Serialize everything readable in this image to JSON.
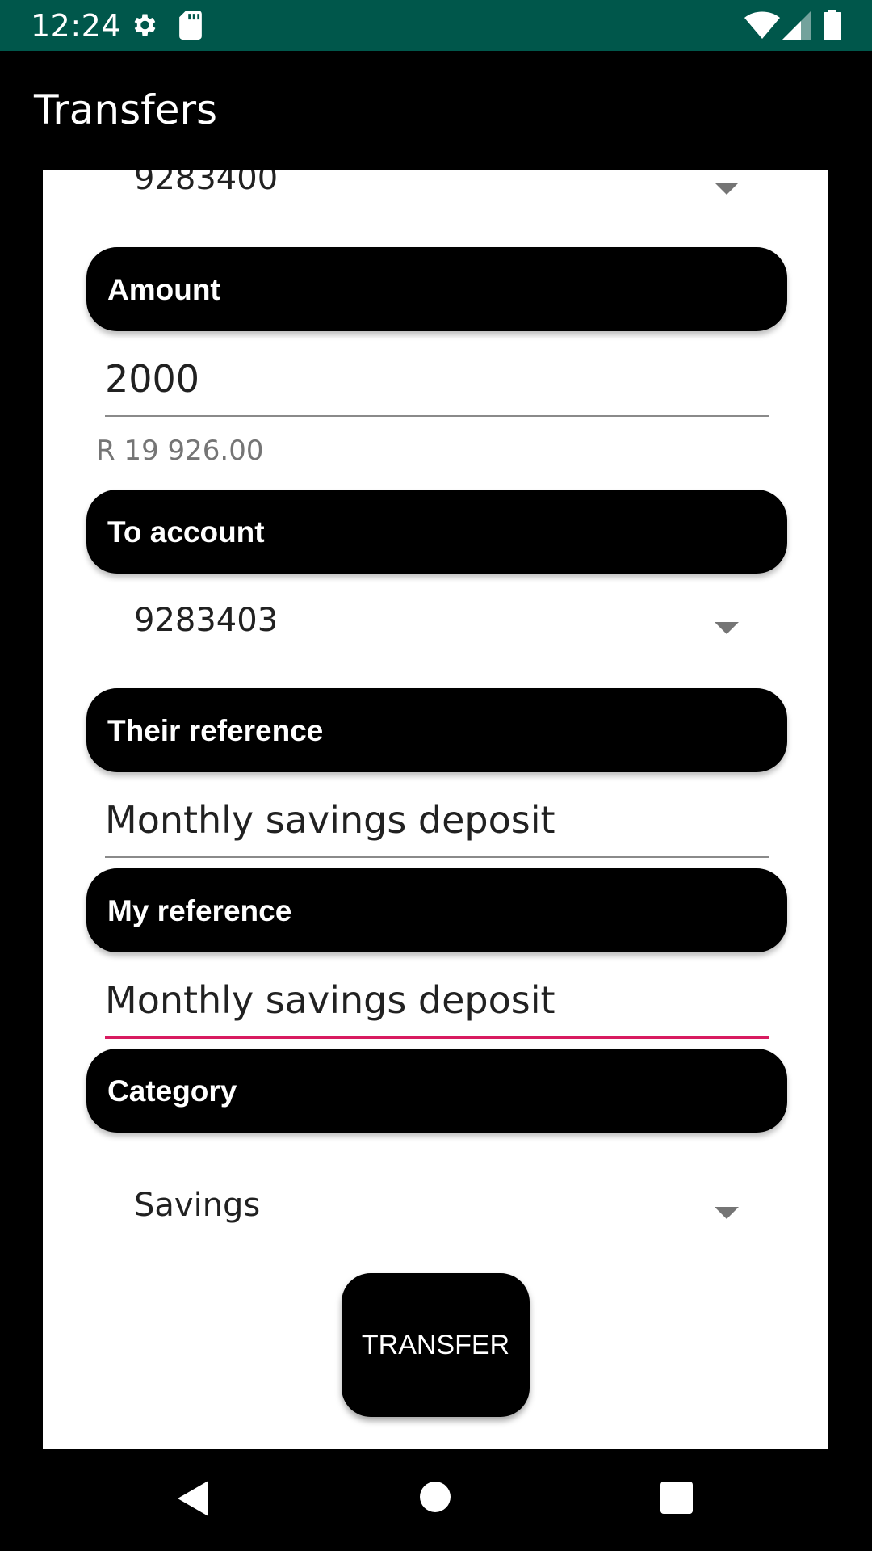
{
  "status_bar": {
    "time": "12:24",
    "icons": [
      "gear-icon",
      "sd-card-icon",
      "wifi-icon",
      "signal-icon",
      "battery-icon"
    ]
  },
  "app_bar": {
    "title": "Transfers"
  },
  "form": {
    "from_account": {
      "value": "9283400"
    },
    "amount": {
      "label": "Amount",
      "value": "2000",
      "balance": "R 19 926.00"
    },
    "to_account": {
      "label": "To account",
      "value": "9283403"
    },
    "their_reference": {
      "label": "Their reference",
      "value": "Monthly savings deposit"
    },
    "my_reference": {
      "label": "My reference",
      "value": "Monthly savings deposit"
    },
    "category": {
      "label": "Category",
      "value": "Savings"
    },
    "transfer_label": "TRANSFER"
  },
  "colors": {
    "status_bar": "#00574b",
    "accent": "#d81b60",
    "header": "#000000"
  }
}
